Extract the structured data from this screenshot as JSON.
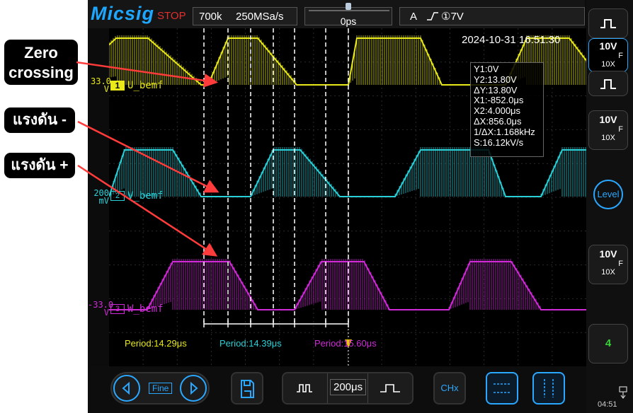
{
  "annotations": {
    "zero_crossing": "Zero\ncrossing",
    "voltage_minus": "แรงดัน -",
    "voltage_plus": "แรงดัน +"
  },
  "top_bar": {
    "brand": "Micsig",
    "run_state": "STOP",
    "memory_depth": "700k",
    "sample_rate": "250MSa/s",
    "trigger_position": "0ps",
    "trigger_mode": "A",
    "trigger_source": "①7V"
  },
  "screen": {
    "timestamp": "2024-10-31 16:51:30",
    "channels": [
      {
        "id": "1",
        "name": "U_bemf",
        "scale_top": "33.0",
        "scale_bottom": "V",
        "color": "#e8e81a"
      },
      {
        "id": "2",
        "name": "V_bemf",
        "scale_top": "200",
        "scale_bottom": "mV",
        "color": "#2ad0d8"
      },
      {
        "id": "3",
        "name": "W_bemf",
        "scale_top": "-33.0",
        "scale_bottom": "V",
        "color": "#d02ad8"
      }
    ],
    "cursor_readout": [
      "Y1:0V",
      "Y2:13.80V",
      "ΔY:13.80V",
      "X1:-852.0μs",
      "X2:4.000μs",
      "ΔX:856.0μs",
      "1/ΔX:1.168kHz",
      "S:16.12kV/s"
    ],
    "measurements": [
      {
        "label": "Period:14.29μs",
        "color": "#e8e81a"
      },
      {
        "label": "Period:14.39μs",
        "color": "#2ad0d8"
      },
      {
        "label": "Period:15.60μs",
        "color": "#d02ad8"
      }
    ]
  },
  "right_panel": {
    "ch1": {
      "volts": "10V",
      "coupling": "F",
      "probe": "10X"
    },
    "ch2": {
      "volts": "10V",
      "coupling": "F",
      "probe": "10X"
    },
    "ch3": {
      "volts": "10V",
      "coupling": "F",
      "probe": "10X"
    },
    "level_label": "Level",
    "channel_count": "4"
  },
  "bottom_bar": {
    "fine_label": "Fine",
    "timebase": "200μs",
    "chx_label": "CHx",
    "clock": "04:51"
  }
}
